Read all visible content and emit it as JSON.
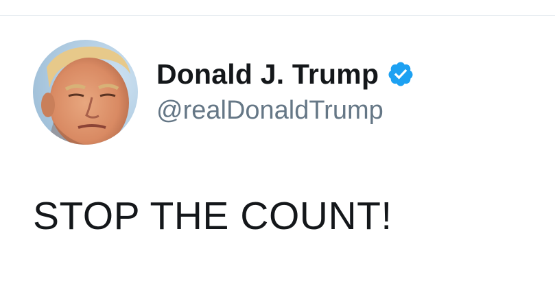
{
  "tweet": {
    "author": {
      "display_name": "Donald J. Trump",
      "handle": "@realDonaldTrump",
      "verified": true,
      "verified_icon": "verified-badge-icon",
      "avatar": "profile-photo"
    },
    "text": "STOP THE COUNT!"
  },
  "colors": {
    "text_primary": "#14171a",
    "text_secondary": "#657786",
    "verified_blue": "#1da1f2",
    "divider": "#e6ecf0",
    "background": "#ffffff"
  }
}
